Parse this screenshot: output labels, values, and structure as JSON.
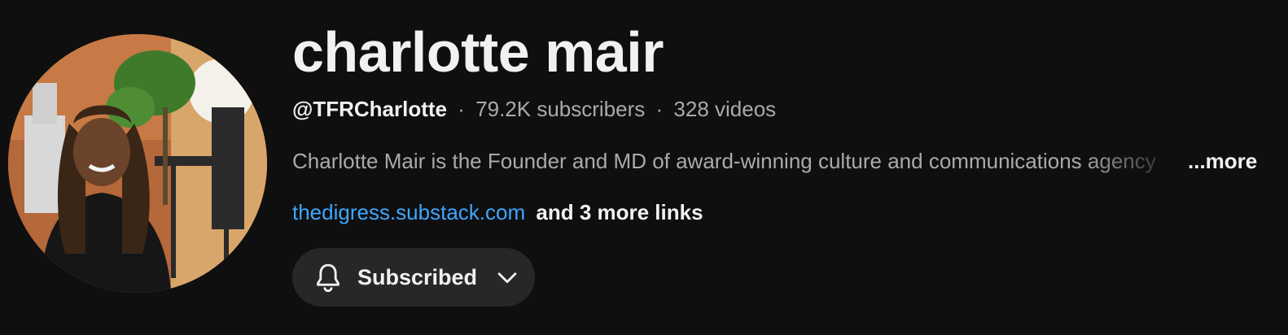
{
  "channel": {
    "name": "charlotte mair",
    "handle": "@TFRCharlotte",
    "separator": "·",
    "subscribers": "79.2K subscribers",
    "videos": "328 videos",
    "description": "Charlotte Mair is the Founder and MD of award-winning culture and communications agency",
    "more_label": "...more",
    "link_text": "thedigress.substack.com",
    "more_links_label": "and 3 more links"
  },
  "subscribe": {
    "label": "Subscribed",
    "bell_icon": "bell-icon",
    "chevron_icon": "chevron-down-icon"
  },
  "colors": {
    "background": "#0f0f0f",
    "link": "#3ea6ff",
    "button_bg": "#272727",
    "secondary_text": "#aaaaaa"
  }
}
